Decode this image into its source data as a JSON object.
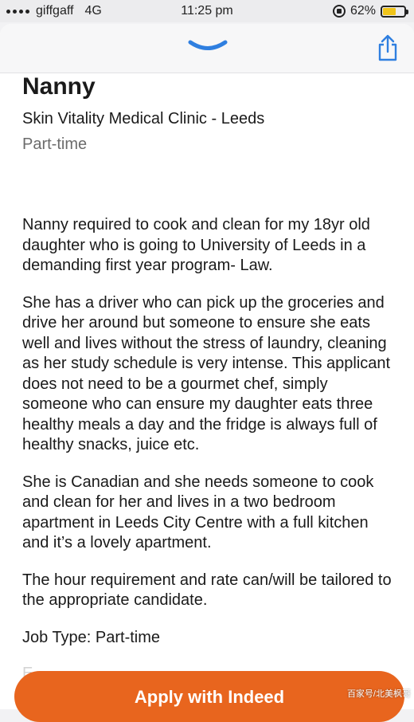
{
  "status_bar": {
    "carrier": "giffgaff",
    "network": "4G",
    "time": "11:25 pm",
    "battery": "62%",
    "battery_level": 0.62
  },
  "header": {
    "collapse_icon": "chevron-down-icon",
    "share_icon": "share-icon",
    "accent_color": "#2f7fe0"
  },
  "job": {
    "title": "Nanny",
    "company_location": "Skin Vitality Medical Clinic - Leeds",
    "employment_type": "Part-time"
  },
  "description": {
    "paragraphs": [
      "Nanny required to cook and clean for my 18yr old daughter who is going to University of Leeds in a demanding first year program- Law.",
      "She has a driver who can pick up the groceries and drive her around but someone to ensure she eats well and lives without the stress of laundry, cleaning as her study schedule is very intense. This applicant does not need to be a gourmet chef, simply someone who can ensure my daughter eats three healthy meals a day and the fridge is always full of healthy snacks, juice etc.",
      "She is Canadian and she needs someone to cook and clean for her and lives in a two bedroom apartment in Leeds City Centre with a full kitchen and it’s a lovely apartment.",
      "The hour requirement and rate can/will be tailored to the appropriate candidate."
    ],
    "job_type_line": "Job Type: Part-time",
    "faded_text": "E..."
  },
  "apply": {
    "label": "Apply with Indeed",
    "color": "#e8651e"
  },
  "watermark": "百家号/北美枫哥"
}
